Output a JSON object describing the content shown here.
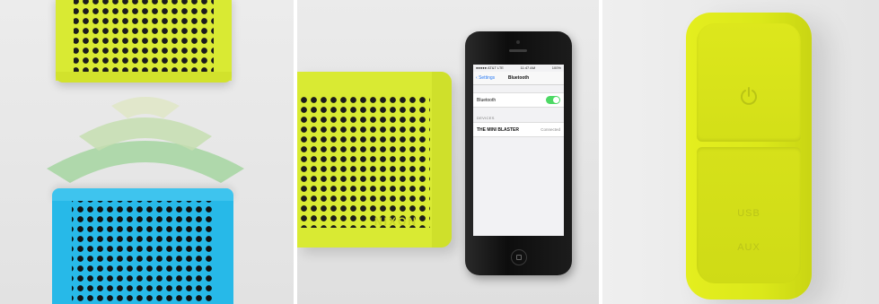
{
  "panels": {
    "left": {
      "speaker_top_color": "#d9ea33",
      "speaker_bottom_color": "#27b9e8",
      "wave_color": "#b7d9a6"
    },
    "middle": {
      "speaker_color": "#d9ea33",
      "speaker_brand": "NIXON",
      "phone": {
        "status_left": "●●●●● AT&T LTE",
        "status_time": "11:47 AM",
        "status_right": "100%",
        "back_label": "Settings",
        "nav_title": "Bluetooth",
        "bluetooth_row_label": "Bluetooth",
        "bluetooth_on": true,
        "devices_header": "DEVICES",
        "device_name": "THE MINI BLASTER",
        "device_status": "Connected"
      }
    },
    "right": {
      "body_color": "#dde71c",
      "power_icon": "power-icon",
      "port_label_usb": "USB",
      "port_label_aux": "AUX"
    }
  }
}
